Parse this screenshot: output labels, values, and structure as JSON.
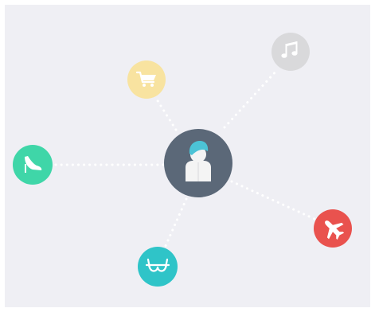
{
  "hub": {
    "icon": "user-avatar-icon",
    "color": "#5b6878",
    "hair_color": "#4cc3d6",
    "shirt_color": "#f4f4f4"
  },
  "nodes": [
    {
      "id": "shopping-cart",
      "icon": "shopping-cart-icon",
      "color": "#f8e3a0",
      "glyph_color": "#ffffff"
    },
    {
      "id": "music",
      "icon": "music-note-icon",
      "color": "#d9d9db",
      "glyph_color": "#ffffff"
    },
    {
      "id": "high-heel",
      "icon": "high-heel-shoe-icon",
      "color": "#3fd6a8",
      "glyph_color": "#ffffff"
    },
    {
      "id": "airplane",
      "icon": "airplane-icon",
      "color": "#e9524e",
      "glyph_color": "#ffffff"
    },
    {
      "id": "bra",
      "icon": "bra-icon",
      "color": "#2fc4c8",
      "glyph_color": "#ffffff"
    }
  ],
  "background_color": "#efeff4"
}
